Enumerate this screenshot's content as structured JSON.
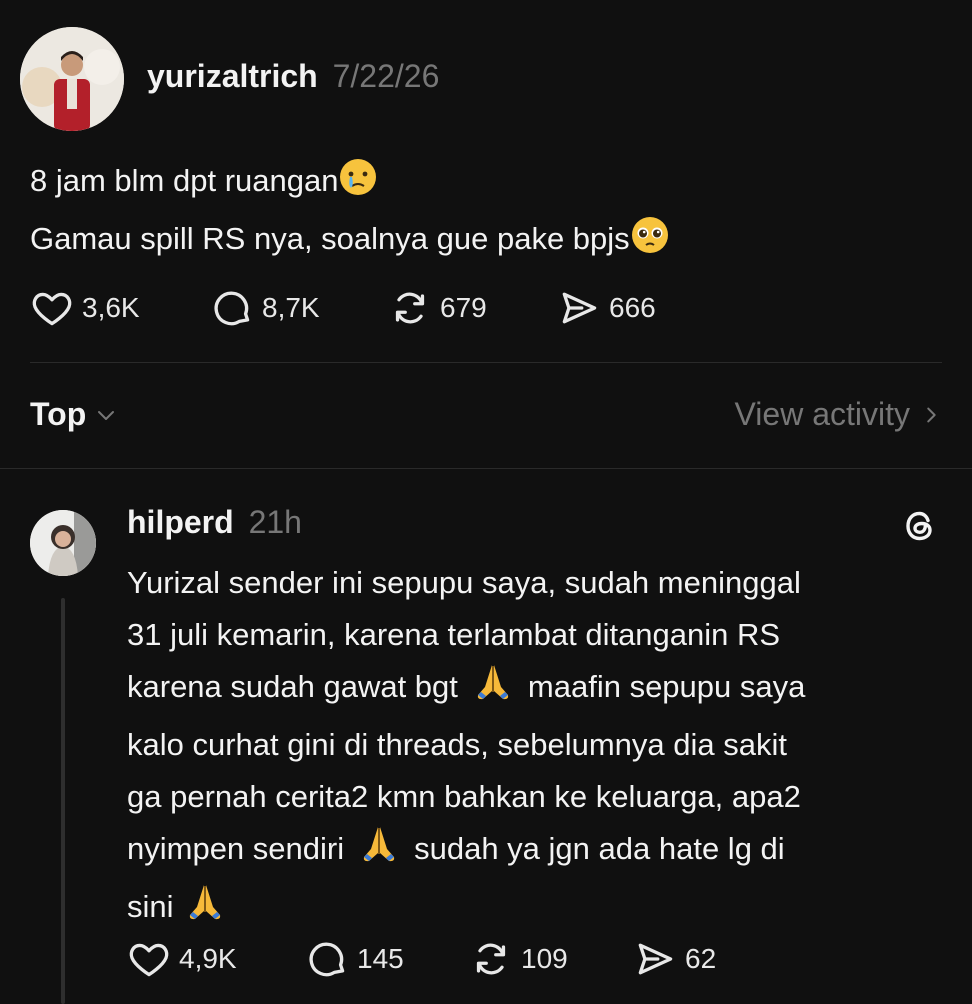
{
  "post": {
    "username": "yurizaltrich",
    "date": "7/22/26",
    "line1": "8 jam blm dpt ruangan",
    "line1_emoji": "face-holding-back-tears",
    "line2": "Gamau spill RS nya, soalnya gue pake bpjs",
    "line2_emoji": "pleading-face",
    "likes": "3,6K",
    "replies": "8,7K",
    "reposts": "679",
    "shares": "666"
  },
  "sort": {
    "label": "Top",
    "view_activity": "View activity"
  },
  "reply": {
    "username": "hilperd",
    "time": "21h",
    "lines": [
      "Yurizal sender ini sepupu saya, sudah meninggal",
      "31 juli kemarin, karena terlambat ditanganin RS",
      "karena sudah gawat bgt",
      "maafin sepupu saya",
      "kalo curhat gini di threads, sebelumnya dia sakit",
      "ga pernah cerita2 kmn bahkan ke keluarga, apa2",
      "nyimpen sendiri",
      "sudah ya jgn ada hate lg di",
      "sini"
    ],
    "emoji": "folded-hands",
    "likes": "4,9K",
    "replies": "145",
    "reposts": "109",
    "shares": "62"
  },
  "colors": {
    "background": "#101010",
    "text": "#f3f3f3",
    "muted": "#777777",
    "divider": "#2a2a2a"
  }
}
